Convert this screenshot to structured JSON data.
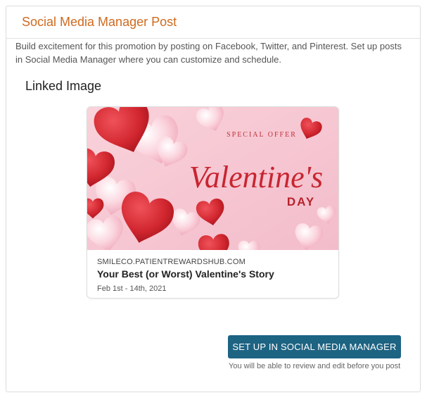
{
  "panel": {
    "title": "Social Media Manager Post",
    "description": "Build excitement for this promotion by posting on Facebook, Twitter, and Pinterest. Set up posts in Social Media Manager where you can customize and schedule."
  },
  "linked_image": {
    "heading": "Linked Image",
    "image": {
      "special_offer": "SPECIAL OFFER",
      "word_main": "Valentine's",
      "word_day": "DAY"
    },
    "domain": "SMILECO.PATIENTREWARDSHUB.COM",
    "title": "Your Best (or Worst) Valentine's Story",
    "date": "Feb 1st - 14th, 2021"
  },
  "action": {
    "button_label": "SET UP IN SOCIAL MEDIA MANAGER",
    "note": "You will be able to review and edit before you post"
  },
  "colors": {
    "title_orange": "#cf6a1f",
    "button_blue": "#1d6382",
    "heart_red": "#d1262f",
    "heart_pink": "#f4b3c2",
    "image_bg": "#f7c9d3"
  }
}
